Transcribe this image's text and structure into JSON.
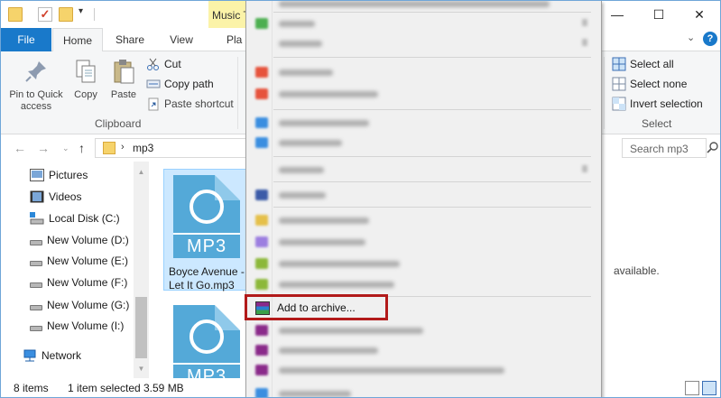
{
  "titlebar": {
    "contextual_tab": "Music T",
    "minimize": "—",
    "maximize": "☐",
    "close": "✕"
  },
  "tabs": {
    "file": "File",
    "home": "Home",
    "share": "Share",
    "view": "View",
    "play": "Pla"
  },
  "ribbon": {
    "pin_label": "Pin to Quick access",
    "copy_label": "Copy",
    "paste_label": "Paste",
    "cut_label": "Cut",
    "copy_path_label": "Copy path",
    "paste_shortcut_label": "Paste shortcut",
    "clipboard_group": "Clipboard",
    "select_all_label": "Select all",
    "select_none_label": "Select none",
    "invert_selection_label": "Invert selection",
    "select_group": "Select"
  },
  "address": {
    "path": "mp3",
    "search_placeholder": "Search mp3"
  },
  "nav": {
    "items": [
      {
        "label": "Pictures",
        "icon": "pictures-icon"
      },
      {
        "label": "Videos",
        "icon": "videos-icon"
      },
      {
        "label": "Local Disk (C:)",
        "icon": "drive-icon"
      },
      {
        "label": "New Volume (D:)",
        "icon": "drive-icon"
      },
      {
        "label": "New Volume (E:)",
        "icon": "drive-icon"
      },
      {
        "label": "New Volume (F:)",
        "icon": "drive-icon"
      },
      {
        "label": "New Volume (G:)",
        "icon": "drive-icon"
      },
      {
        "label": "New Volume (I:)",
        "icon": "drive-icon"
      },
      {
        "label": "Network",
        "icon": "network-icon"
      }
    ]
  },
  "files": {
    "items": [
      {
        "type_label": "MP3",
        "name_line1": "Boyce Avenue -",
        "name_line2": "Let It Go.mp3"
      },
      {
        "type_label": "MP3",
        "name_line1": "",
        "name_line2": ""
      }
    ],
    "preview_text": "available."
  },
  "status": {
    "item_count": "8 items",
    "selected": "1 item selected",
    "size": "3.59 MB"
  },
  "context_menu": {
    "add_to_archive": "Add to archive..."
  },
  "colors": {
    "file_tab": "#1979ca",
    "music_tab": "#fbf3a8",
    "selection": "#cce8ff",
    "mp3_icon": "#54a9d8",
    "highlight_box": "#b21a1a"
  }
}
